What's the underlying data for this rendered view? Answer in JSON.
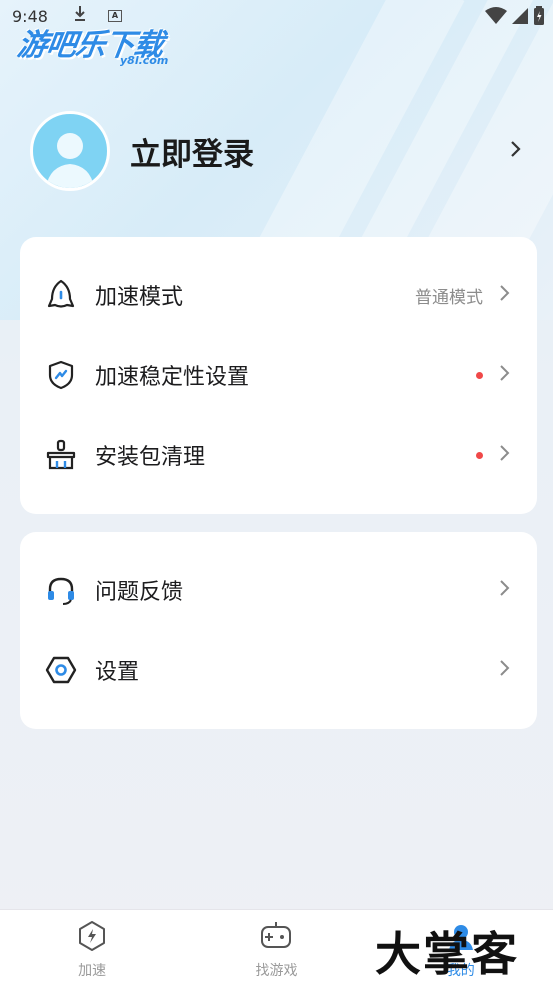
{
  "status_bar": {
    "time": "9:48",
    "download_icon": "download-arrow-icon",
    "a_icon": "A",
    "right_icons": [
      "wifi-icon",
      "signal-icon",
      "battery-icon"
    ]
  },
  "brand": {
    "name": "游吧乐下载",
    "domain": "y8l.com"
  },
  "profile": {
    "login_label": "立即登录",
    "avatar_icon": "user-avatar-icon"
  },
  "menu_group_1": [
    {
      "label": "加速模式",
      "value": "普通模式",
      "icon": "rocket-icon",
      "dot": false
    },
    {
      "label": "加速稳定性设置",
      "value": "",
      "icon": "shield-icon",
      "dot": true
    },
    {
      "label": "安装包清理",
      "value": "",
      "icon": "broom-icon",
      "dot": true
    }
  ],
  "menu_group_2": [
    {
      "label": "问题反馈",
      "icon": "headset-icon"
    },
    {
      "label": "设置",
      "icon": "hexagon-settings-icon"
    }
  ],
  "tabs": [
    {
      "label": "加速",
      "icon": "lightning-hex-icon",
      "active": false
    },
    {
      "label": "找游戏",
      "icon": "gamepad-icon",
      "active": false
    },
    {
      "label": "我的",
      "icon": "profile-icon",
      "active": true
    }
  ],
  "watermark": "大掌客",
  "colors": {
    "accent": "#2e8be6",
    "red_dot": "#f04848",
    "avatar": "#7fd3f3"
  }
}
